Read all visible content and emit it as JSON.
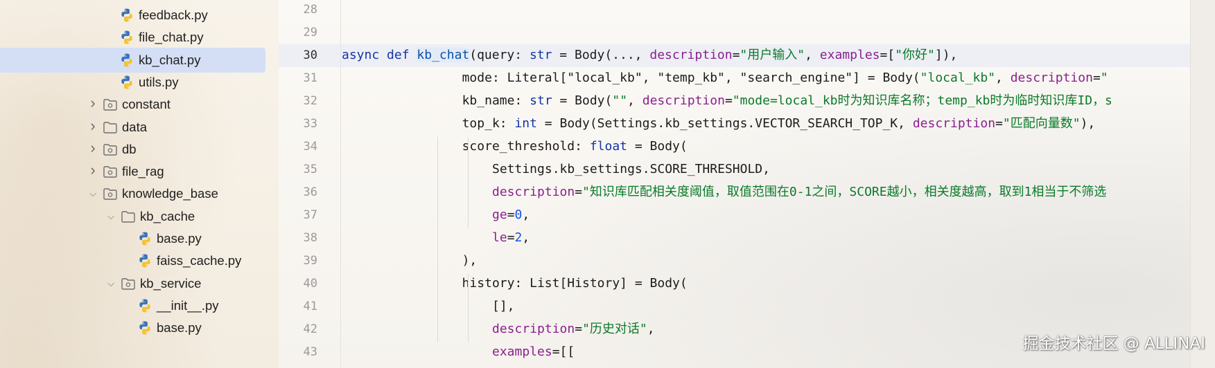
{
  "tree": {
    "items": [
      {
        "label": "feedback.py",
        "kind": "python",
        "depth": 2,
        "expander": "none",
        "selected": false
      },
      {
        "label": "file_chat.py",
        "kind": "python",
        "depth": 2,
        "expander": "none",
        "selected": false
      },
      {
        "label": "kb_chat.py",
        "kind": "python",
        "depth": 2,
        "expander": "none",
        "selected": true
      },
      {
        "label": "utils.py",
        "kind": "python",
        "depth": 2,
        "expander": "none",
        "selected": false
      },
      {
        "label": "constant",
        "kind": "package",
        "depth": 1,
        "expander": "collapsed",
        "selected": false
      },
      {
        "label": "data",
        "kind": "folder",
        "depth": 1,
        "expander": "collapsed",
        "selected": false
      },
      {
        "label": "db",
        "kind": "package",
        "depth": 1,
        "expander": "collapsed",
        "selected": false
      },
      {
        "label": "file_rag",
        "kind": "package",
        "depth": 1,
        "expander": "collapsed",
        "selected": false
      },
      {
        "label": "knowledge_base",
        "kind": "package",
        "depth": 1,
        "expander": "expanded",
        "selected": false
      },
      {
        "label": "kb_cache",
        "kind": "folder",
        "depth": 2,
        "expander": "expanded",
        "selected": false
      },
      {
        "label": "base.py",
        "kind": "python",
        "depth": 3,
        "expander": "none",
        "selected": false
      },
      {
        "label": "faiss_cache.py",
        "kind": "python",
        "depth": 3,
        "expander": "none",
        "selected": false
      },
      {
        "label": "kb_service",
        "kind": "package",
        "depth": 2,
        "expander": "expanded",
        "selected": false
      },
      {
        "label": "__init__.py",
        "kind": "python",
        "depth": 3,
        "expander": "none",
        "selected": false
      },
      {
        "label": "base.py",
        "kind": "python",
        "depth": 3,
        "expander": "none",
        "selected": false
      }
    ]
  },
  "editor": {
    "current_line": 30,
    "lines": [
      {
        "num": "28",
        "indent": 0,
        "tokens": []
      },
      {
        "num": "29",
        "indent": 0,
        "tokens": []
      },
      {
        "num": "30",
        "indent": 0,
        "tokens": [
          {
            "t": "async",
            "c": "kw"
          },
          {
            "t": " "
          },
          {
            "t": "def",
            "c": "kw"
          },
          {
            "t": " "
          },
          {
            "t": "kb_chat",
            "c": "fn"
          },
          {
            "t": "(query: "
          },
          {
            "t": "str",
            "c": "kw"
          },
          {
            "t": " = Body(..., "
          },
          {
            "t": "description",
            "c": "kwa"
          },
          {
            "t": "="
          },
          {
            "t": "\"用户输入\"",
            "c": "str"
          },
          {
            "t": ", "
          },
          {
            "t": "examples",
            "c": "kwa"
          },
          {
            "t": "=["
          },
          {
            "t": "\"你好\"",
            "c": "str"
          },
          {
            "t": "]),"
          }
        ]
      },
      {
        "num": "31",
        "indent": 4,
        "tokens": [
          {
            "t": "mode: Literal[\"local_kb\", \"temp_kb\", \"search_engine\"] = Body("
          },
          {
            "t": "\"local_kb\"",
            "c": "str"
          },
          {
            "t": ", "
          },
          {
            "t": "description",
            "c": "kwa"
          },
          {
            "t": "="
          },
          {
            "t": "\"",
            "c": "str"
          }
        ]
      },
      {
        "num": "32",
        "indent": 4,
        "tokens": [
          {
            "t": "kb_name: "
          },
          {
            "t": "str",
            "c": "kw"
          },
          {
            "t": " = Body("
          },
          {
            "t": "\"\"",
            "c": "str"
          },
          {
            "t": ", "
          },
          {
            "t": "description",
            "c": "kwa"
          },
          {
            "t": "="
          },
          {
            "t": "\"mode=local_kb时为知识库名称；temp_kb时为临时知识库ID，s",
            "c": "str"
          }
        ]
      },
      {
        "num": "33",
        "indent": 4,
        "tokens": [
          {
            "t": "top_k: "
          },
          {
            "t": "int",
            "c": "kw"
          },
          {
            "t": " = Body(Settings.kb_settings.VECTOR_SEARCH_TOP_K, "
          },
          {
            "t": "description",
            "c": "kwa"
          },
          {
            "t": "="
          },
          {
            "t": "\"匹配向量数\"",
            "c": "str"
          },
          {
            "t": "),"
          }
        ]
      },
      {
        "num": "34",
        "indent": 4,
        "tokens": [
          {
            "t": "score_threshold: "
          },
          {
            "t": "float",
            "c": "kw"
          },
          {
            "t": " = Body("
          }
        ]
      },
      {
        "num": "35",
        "indent": 5,
        "tokens": [
          {
            "t": "Settings.kb_settings.SCORE_THRESHOLD,"
          }
        ]
      },
      {
        "num": "36",
        "indent": 5,
        "tokens": [
          {
            "t": "description",
            "c": "kwa"
          },
          {
            "t": "="
          },
          {
            "t": "\"知识库匹配相关度阈值，取值范围在0-1之间，SCORE越小，相关度越高，取到1相当于不筛选",
            "c": "str"
          }
        ]
      },
      {
        "num": "37",
        "indent": 5,
        "tokens": [
          {
            "t": "ge",
            "c": "kwa"
          },
          {
            "t": "="
          },
          {
            "t": "0",
            "c": "num"
          },
          {
            "t": ","
          }
        ]
      },
      {
        "num": "38",
        "indent": 5,
        "tokens": [
          {
            "t": "le",
            "c": "kwa"
          },
          {
            "t": "="
          },
          {
            "t": "2",
            "c": "num"
          },
          {
            "t": ","
          }
        ]
      },
      {
        "num": "39",
        "indent": 4,
        "tokens": [
          {
            "t": "),"
          }
        ]
      },
      {
        "num": "40",
        "indent": 4,
        "tokens": [
          {
            "t": "history: List[History] = Body("
          }
        ]
      },
      {
        "num": "41",
        "indent": 5,
        "tokens": [
          {
            "t": "[],"
          }
        ]
      },
      {
        "num": "42",
        "indent": 5,
        "tokens": [
          {
            "t": "description",
            "c": "kwa"
          },
          {
            "t": "="
          },
          {
            "t": "\"历史对话\"",
            "c": "str"
          },
          {
            "t": ","
          }
        ]
      },
      {
        "num": "43",
        "indent": 5,
        "tokens": [
          {
            "t": "examples",
            "c": "kwa"
          },
          {
            "t": "=[["
          }
        ]
      }
    ]
  },
  "watermark": "掘金技术社区 @ ALLINAI",
  "colors": {
    "selection": "#d4dff6",
    "keyword": "#1335a8",
    "string": "#0a7a2a",
    "kwarg": "#8a1f8f",
    "number": "#1750eb",
    "python_blue": "#3a73b5",
    "python_yellow": "#f2c230"
  },
  "icons": {
    "python": "python-file-icon",
    "folder": "folder-icon",
    "package": "package-folder-icon",
    "collapsed": "chevron-right-icon",
    "expanded": "chevron-down-icon"
  }
}
